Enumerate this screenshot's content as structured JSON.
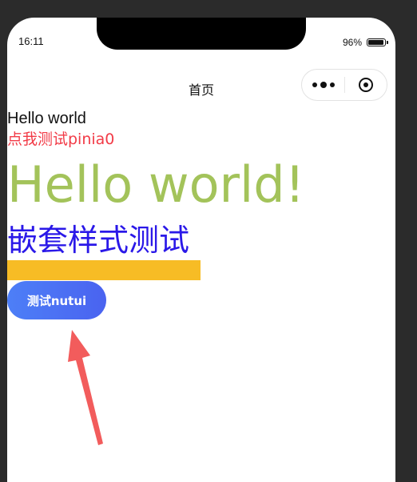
{
  "status_bar": {
    "time": "16:11",
    "battery_percent": "96%",
    "battery_level": 0.96
  },
  "nav_bar": {
    "title": "首页",
    "capsule_icons": [
      "more-icon",
      "target-icon"
    ]
  },
  "content": {
    "hello_small": "Hello world",
    "pinia_test": "点我测试pinia0",
    "hello_big": "Hello world!",
    "nested_style_test": "嵌套样式测试",
    "nutui_button_label": "测试nutui"
  },
  "colors": {
    "pinia_text": "#f23b47",
    "hello_big": "#a3c35a",
    "nested_text": "#2a18e8",
    "yellow_bar": "#f7bc25",
    "button_gradient_start": "#4d7ff7",
    "button_gradient_end": "#4a63f0",
    "annotation_arrow": "#f25c5c"
  }
}
